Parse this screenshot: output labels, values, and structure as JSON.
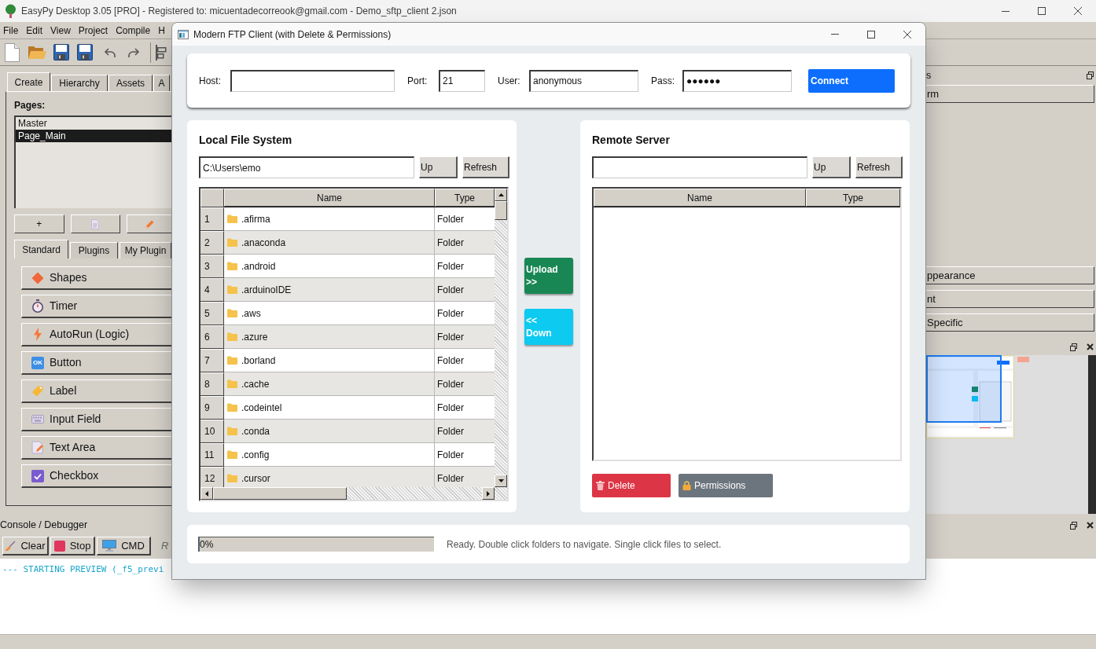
{
  "app_window": {
    "title": "EasyPy Desktop 3.05 [PRO] - Registered to: micuentadecorreook@gmail.com - Demo_sftp_client 2.json"
  },
  "menu_bar": [
    "File",
    "Edit",
    "View",
    "Project",
    "Compile",
    "H"
  ],
  "left_panel": {
    "tabs": [
      {
        "label": "Create",
        "selected": true
      },
      {
        "label": "Hierarchy",
        "selected": false
      },
      {
        "label": "Assets",
        "selected": false
      },
      {
        "label": "A",
        "selected": false
      }
    ],
    "pages_label": "Pages:",
    "pages": [
      {
        "label": "Master",
        "selected": false
      },
      {
        "label": "Page_Main",
        "selected": true
      }
    ],
    "add_page_button": "+",
    "component_tabs": [
      {
        "label": "Standard",
        "selected": true
      },
      {
        "label": "Plugins",
        "selected": false
      },
      {
        "label": "My Plugin",
        "selected": false
      }
    ],
    "components": [
      {
        "kind": "shapes",
        "label": "Shapes"
      },
      {
        "kind": "timer",
        "label": "Timer"
      },
      {
        "kind": "logic",
        "label": "AutoRun (Logic)"
      },
      {
        "kind": "button",
        "label": "Button",
        "icon_text": "OK"
      },
      {
        "kind": "label",
        "label": "Label"
      },
      {
        "kind": "input",
        "label": "Input Field"
      },
      {
        "kind": "textarea",
        "label": "Text Area"
      },
      {
        "kind": "checkbox",
        "label": "Checkbox"
      }
    ]
  },
  "right_panel": {
    "header": "s",
    "form_button": "rm",
    "property_groups": [
      "ppearance",
      "nt",
      "Specific"
    ]
  },
  "console": {
    "title": "Console / Debugger",
    "buttons": [
      {
        "kind": "clear",
        "label": "Clear"
      },
      {
        "kind": "stop",
        "label": "Stop"
      },
      {
        "kind": "cmd",
        "label": "CMD"
      }
    ],
    "status": "R",
    "output": [
      "--- STARTING PREVIEW (_f5_previ"
    ]
  },
  "ftp_window": {
    "title": "Modern FTP Client (with Delete & Permissions)",
    "connection": {
      "fields": [
        {
          "label": "Host:"
        },
        {
          "label": "Port:",
          "value": "21"
        },
        {
          "label": "User:",
          "value": "anonymous"
        },
        {
          "label": "Pass:",
          "value": "●●●●●●"
        }
      ],
      "connect_button": "Connect"
    },
    "local": {
      "title": "Local File System",
      "path": "C:\\Users\\emo",
      "up_button": "Up",
      "refresh_button": "Refresh",
      "columns": [
        "Name",
        "Type"
      ],
      "rows": [
        {
          "index": "1",
          "name": ".afirma",
          "type": "Folder",
          "selected": false
        },
        {
          "index": "2",
          "name": ".anaconda",
          "type": "Folder",
          "selected": false
        },
        {
          "index": "3",
          "name": ".android",
          "type": "Folder",
          "selected": false
        },
        {
          "index": "4",
          "name": ".arduinoIDE",
          "type": "Folder",
          "selected": false
        },
        {
          "index": "5",
          "name": ".aws",
          "type": "Folder",
          "selected": false
        },
        {
          "index": "6",
          "name": ".azure",
          "type": "Folder",
          "selected": false
        },
        {
          "index": "7",
          "name": ".borland",
          "type": "Folder",
          "selected": false
        },
        {
          "index": "8",
          "name": ".cache",
          "type": "Folder",
          "selected": false
        },
        {
          "index": "9",
          "name": ".codeintel",
          "type": "Folder",
          "selected": false
        },
        {
          "index": "10",
          "name": ".conda",
          "type": "Folder",
          "selected": false
        },
        {
          "index": "11",
          "name": ".config",
          "type": "Folder",
          "selected": false
        },
        {
          "index": "12",
          "name": ".cursor",
          "type": "Folder",
          "selected": false
        }
      ]
    },
    "transfer_buttons": [
      {
        "kind": "upload",
        "label": "Upload\n>>"
      },
      {
        "kind": "download",
        "label": "<<\nDown"
      }
    ],
    "remote": {
      "title": "Remote Server",
      "up_button": "Up",
      "refresh_button": "Refresh",
      "columns": [
        "Name",
        "Type"
      ],
      "actions": [
        {
          "kind": "delete",
          "label": "Delete"
        },
        {
          "kind": "permissions",
          "label": "Permissions"
        }
      ]
    },
    "status": {
      "progress": {
        "level": 0,
        "reading": "0%"
      },
      "message": "Ready. Double click folders to navigate. Single click files to select."
    }
  }
}
